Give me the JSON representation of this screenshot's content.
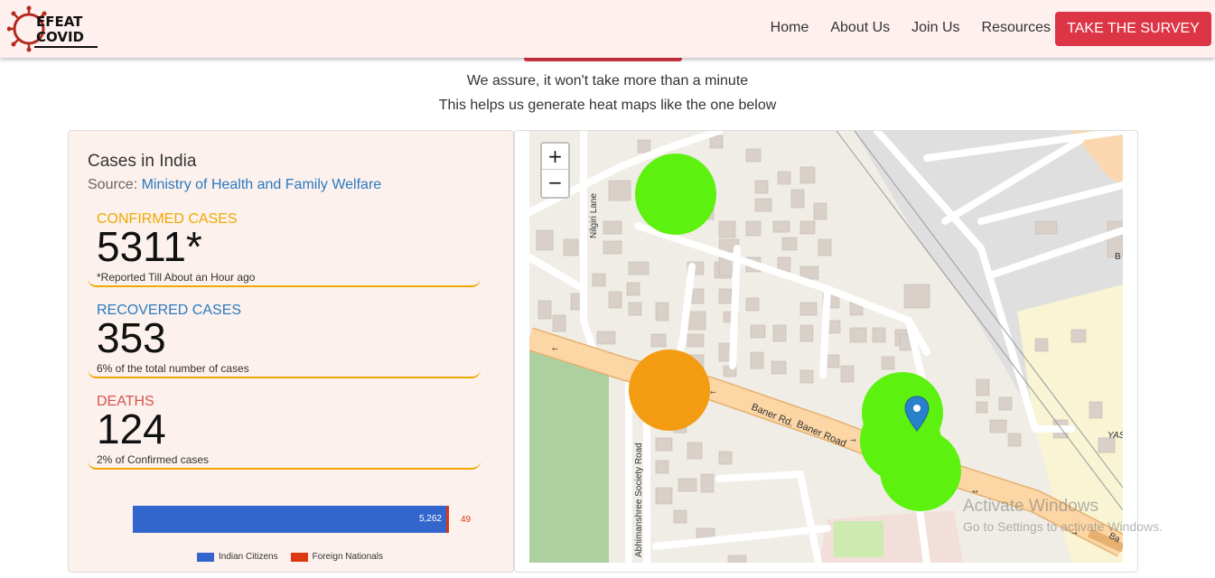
{
  "navbar": {
    "logo_line1": "EFEAT",
    "logo_line2": "COVID",
    "links": [
      "Home",
      "About Us",
      "Join Us",
      "Resources"
    ],
    "cta": "TAKE THE SURVEY"
  },
  "intro": {
    "line1": "We assure, it won't take more than a minute",
    "line2": "This helps us generate heat maps like the one below"
  },
  "stats": {
    "title": "Cases in India",
    "source_prefix": "Source: ",
    "source_link": "Ministry of Health and Family Welfare",
    "confirmed": {
      "label": "CONFIRMED CASES",
      "value": "5311*",
      "note": "*Reported Till About an Hour ago"
    },
    "recovered": {
      "label": "RECOVERED CASES",
      "value": "353",
      "note": "6% of the total number of cases"
    },
    "deaths": {
      "label": "DEATHS",
      "value": "124",
      "note": "2% of Confirmed cases"
    }
  },
  "chart_data": {
    "type": "bar",
    "categories": [
      "Indian Citizens",
      "Foreign Nationals"
    ],
    "values": [
      5262,
      49
    ],
    "value_labels": [
      "5,262",
      "49"
    ],
    "colors": [
      "#3366cc",
      "#dc3912"
    ],
    "legend": [
      "Indian Citizens",
      "Foreign Nationals"
    ]
  },
  "map": {
    "zoom_in": "+",
    "zoom_out": "−",
    "street_labels": [
      "Nilgiri Lane",
      "Baner Rd.",
      "Baner Road",
      "Abhimanshree Society Road",
      "Ba",
      "YAS",
      "B"
    ],
    "heat_colors": {
      "low": "#5df10f",
      "medium": "#f39c12"
    },
    "marker_color": "#2a81cb"
  },
  "os_watermark": {
    "line1": "Activate Windows",
    "line2": "Go to Settings to activate Windows."
  }
}
